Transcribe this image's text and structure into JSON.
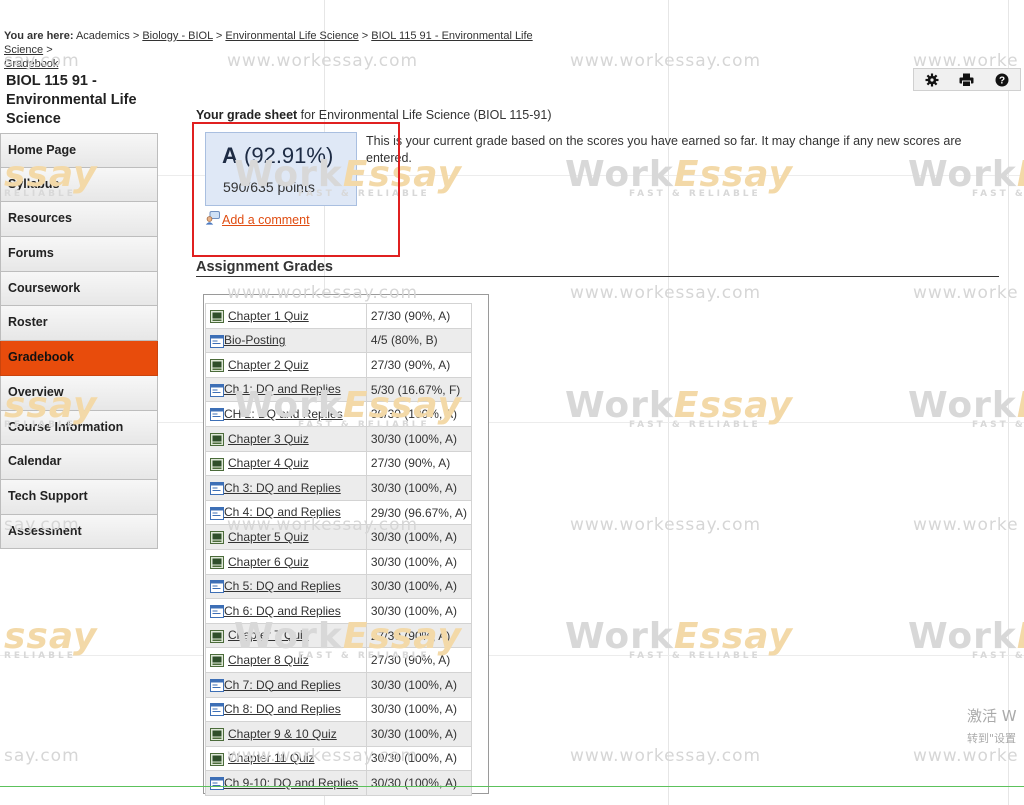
{
  "breadcrumb": {
    "prefix": "You are here:",
    "root": "Academics",
    "links": [
      "Biology - BIOL",
      "Environmental Life Science",
      "BIOL 115 91 - Environmental Life Science",
      "Gradebook"
    ],
    "separator": ">"
  },
  "course": {
    "title": "BIOL 115 91 - Environmental Life Science"
  },
  "sidebar": {
    "active_index": 6,
    "items": [
      {
        "label": "Home Page"
      },
      {
        "label": "Syllabus"
      },
      {
        "label": "Resources"
      },
      {
        "label": "Forums"
      },
      {
        "label": "Coursework"
      },
      {
        "label": "Roster"
      },
      {
        "label": "Gradebook"
      },
      {
        "label": "Overview"
      },
      {
        "label": "Course Information"
      },
      {
        "label": "Calendar"
      },
      {
        "label": "Tech Support"
      },
      {
        "label": "Assessment"
      }
    ]
  },
  "toolbar": {
    "icons": [
      "gear-icon",
      "print-icon",
      "help-icon"
    ],
    "help_glyph": "?"
  },
  "grade_sheet": {
    "title_bold": "Your grade sheet",
    "title_rest": "for Environmental Life Science (BIOL 115-91)",
    "letter": "A",
    "percent": "(92.91%)",
    "points": "590/635 points",
    "note": "This is your current grade based on the scores you have earned so far. It may change if any new scores are entered.",
    "comment_link": "Add a comment"
  },
  "assignments": {
    "title": "Assignment Grades",
    "rows": [
      {
        "type": "quiz",
        "name": "Chapter 1 Quiz",
        "score": "27/30 (90%, A)"
      },
      {
        "type": "discussion",
        "name": "Bio-Posting",
        "score": "4/5 (80%, B)"
      },
      {
        "type": "quiz",
        "name": "Chapter 2 Quiz",
        "score": "27/30 (90%, A)"
      },
      {
        "type": "discussion",
        "name": "Ch 1: DQ and Replies",
        "score": "5/30 (16.67%, F)"
      },
      {
        "type": "discussion",
        "name": "CH 2: DQ and Replies",
        "score": "30/30 (100%, A)"
      },
      {
        "type": "quiz",
        "name": "Chapter 3 Quiz",
        "score": "30/30 (100%, A)"
      },
      {
        "type": "quiz",
        "name": "Chapter 4 Quiz",
        "score": "27/30 (90%, A)"
      },
      {
        "type": "discussion",
        "name": "Ch 3: DQ and Replies",
        "score": "30/30 (100%, A)"
      },
      {
        "type": "discussion",
        "name": "Ch 4: DQ and Replies",
        "score": "29/30 (96.67%, A)"
      },
      {
        "type": "quiz",
        "name": "Chapter 5 Quiz",
        "score": "30/30 (100%, A)"
      },
      {
        "type": "quiz",
        "name": "Chapter 6 Quiz",
        "score": "30/30 (100%, A)"
      },
      {
        "type": "discussion",
        "name": "Ch 5: DQ and Replies",
        "score": "30/30 (100%, A)"
      },
      {
        "type": "discussion",
        "name": "Ch 6: DQ and Replies",
        "score": "30/30 (100%, A)"
      },
      {
        "type": "quiz",
        "name": "Chapter 7 Quiz",
        "score": "27/30 (90%, A)"
      },
      {
        "type": "quiz",
        "name": "Chapter 8 Quiz",
        "score": "27/30 (90%, A)"
      },
      {
        "type": "discussion",
        "name": "Ch 7: DQ and Replies",
        "score": "30/30 (100%, A)"
      },
      {
        "type": "discussion",
        "name": "Ch 8: DQ and Replies",
        "score": "30/30 (100%, A)"
      },
      {
        "type": "quiz",
        "name": "Chapter 9 & 10 Quiz",
        "score": "30/30 (100%, A)"
      },
      {
        "type": "quiz",
        "name": "Chapter 11 Quiz",
        "score": "30/30 (100%, A)"
      },
      {
        "type": "discussion",
        "name": "Ch 9-10: DQ and Replies",
        "score": "30/30 (100%, A)"
      }
    ]
  },
  "watermark": {
    "site": "www.workessay.com",
    "site_partial": "say.com",
    "site_partial_right": "www.worke",
    "logo_work": "Work",
    "logo_essay": "Essay",
    "logo_tag": "FAST & RELIABLE",
    "logo_partial_left": "ssay",
    "logo_tag_partial_left": "RELIABLE",
    "logo_tag_partial_right": "FAST &",
    "logo_partial_right_essay": "E"
  },
  "os_overlay": {
    "line1": "激活 W",
    "line2": "转到\"设置"
  },
  "colors": {
    "active_nav": "#e84c0c",
    "grade_box": "#dfe8f6",
    "link_orange": "#e04d12",
    "highlight": "#e02020"
  }
}
